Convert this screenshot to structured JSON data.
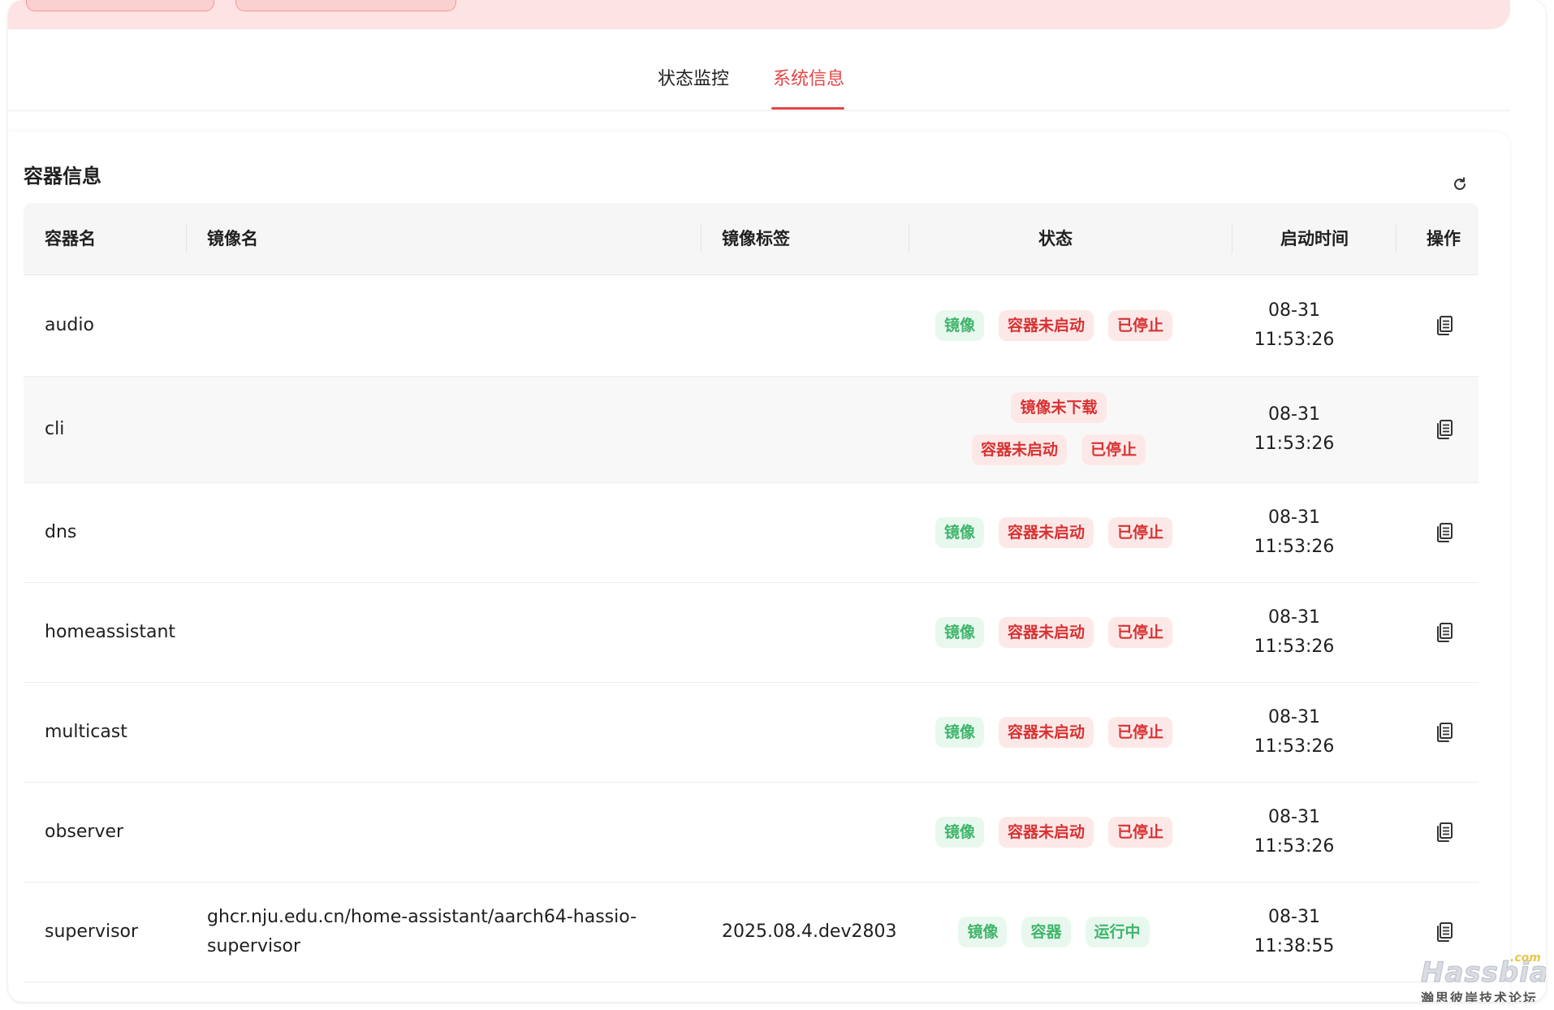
{
  "tabs": [
    {
      "label": "状态监控",
      "active": false
    },
    {
      "label": "系统信息",
      "active": true
    }
  ],
  "section": {
    "title": "容器信息"
  },
  "colors": {
    "accent": "#e54545",
    "badge_green": "#3fb56a",
    "badge_red": "#d83232"
  },
  "table": {
    "headers": [
      "容器名",
      "镜像名",
      "镜像标签",
      "状态",
      "启动时间",
      "操作"
    ],
    "rows": [
      {
        "name": "audio",
        "image": "",
        "tag": "",
        "badges": [
          {
            "text": "镜像",
            "tone": "green"
          },
          {
            "text": "容器未启动",
            "tone": "red"
          },
          {
            "text": "已停止",
            "tone": "red"
          }
        ],
        "date": "08-31",
        "time": "11:53:26",
        "action_icon": "document-icon"
      },
      {
        "name": "cli",
        "image": "",
        "tag": "",
        "badges": [
          {
            "text": "镜像未下载",
            "tone": "red"
          },
          {
            "text": "容器未启动",
            "tone": "red"
          },
          {
            "text": "已停止",
            "tone": "red"
          }
        ],
        "date": "08-31",
        "time": "11:53:26",
        "action_icon": "document-icon"
      },
      {
        "name": "dns",
        "image": "",
        "tag": "",
        "badges": [
          {
            "text": "镜像",
            "tone": "green"
          },
          {
            "text": "容器未启动",
            "tone": "red"
          },
          {
            "text": "已停止",
            "tone": "red"
          }
        ],
        "date": "08-31",
        "time": "11:53:26",
        "action_icon": "document-icon"
      },
      {
        "name": "homeassistant",
        "image": "",
        "tag": "",
        "badges": [
          {
            "text": "镜像",
            "tone": "green"
          },
          {
            "text": "容器未启动",
            "tone": "red"
          },
          {
            "text": "已停止",
            "tone": "red"
          }
        ],
        "date": "08-31",
        "time": "11:53:26",
        "action_icon": "document-icon"
      },
      {
        "name": "multicast",
        "image": "",
        "tag": "",
        "badges": [
          {
            "text": "镜像",
            "tone": "green"
          },
          {
            "text": "容器未启动",
            "tone": "red"
          },
          {
            "text": "已停止",
            "tone": "red"
          }
        ],
        "date": "08-31",
        "time": "11:53:26",
        "action_icon": "document-icon"
      },
      {
        "name": "observer",
        "image": "",
        "tag": "",
        "badges": [
          {
            "text": "镜像",
            "tone": "green"
          },
          {
            "text": "容器未启动",
            "tone": "red"
          },
          {
            "text": "已停止",
            "tone": "red"
          }
        ],
        "date": "08-31",
        "time": "11:53:26",
        "action_icon": "document-icon"
      },
      {
        "name": "supervisor",
        "image": "ghcr.nju.edu.cn/home-assistant/aarch64-hassio-supervisor",
        "tag": "2025.08.4.dev2803",
        "badges": [
          {
            "text": "镜像",
            "tone": "green"
          },
          {
            "text": "容器",
            "tone": "green"
          },
          {
            "text": "运行中",
            "tone": "green"
          }
        ],
        "date": "08-31",
        "time": "11:38:55",
        "action_icon": "document-icon"
      }
    ]
  },
  "watermark": {
    "logo": "Hassbian",
    "suffix": ".com",
    "subtitle": "瀚思彼岸技术论坛"
  }
}
